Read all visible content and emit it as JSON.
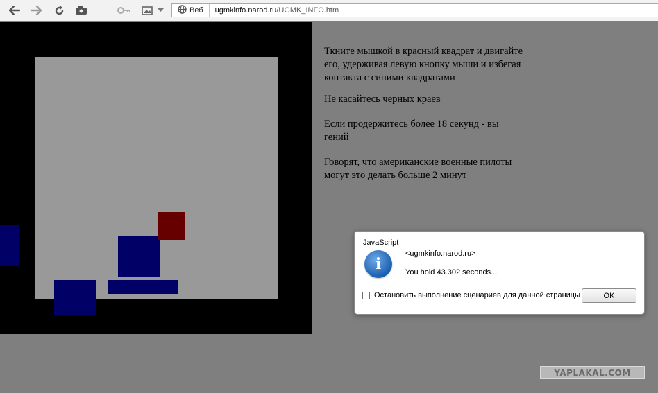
{
  "browser": {
    "web_label": "Веб",
    "url_host": "ugmkinfo.narod.ru",
    "url_path": "/UGMK_INFO.htm",
    "icons": [
      "back-arrow-icon",
      "forward-arrow-icon",
      "reload-icon",
      "camera-icon",
      "key-icon",
      "image-icon",
      "chevron-down-icon",
      "globe-icon"
    ]
  },
  "game": {
    "colors": {
      "border": "#000000",
      "arena": "#999999",
      "enemy": "#000066",
      "player": "#660000"
    }
  },
  "instructions": {
    "p1": "Ткните мышкой в красный квадрат и двигайте его, удерживая левую кнопку мыши и избегая контакта с синими квадратами",
    "p2": "Не касайтесь черных краев",
    "p3": "Если продержитесь более 18 секунд - вы гений",
    "p4": "Говорят, что американские военные пилоты могут это делать больше 2 минут"
  },
  "dialog": {
    "title": "JavaScript",
    "host": "<ugmkinfo.narod.ru>",
    "message": "You hold 43.302 seconds...",
    "checkbox_label": "Остановить выполнение сценариев для данной страницы",
    "checkbox_checked": false,
    "ok_label": "OK",
    "icon": "info-icon"
  },
  "watermark": "YAPLAKAL.COM"
}
